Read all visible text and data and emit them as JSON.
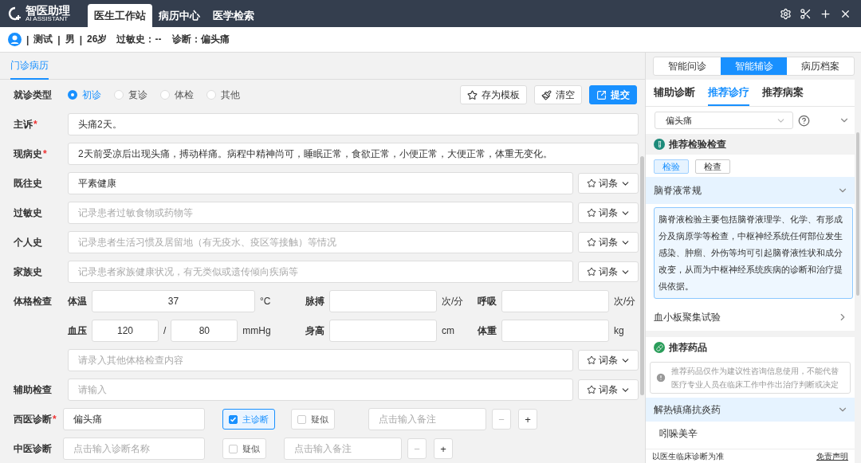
{
  "header": {
    "logo": {
      "name": "智医助理",
      "tagline": "AI ASSISTANT"
    },
    "nav": [
      {
        "label": "医生工作站",
        "selected": true
      },
      {
        "label": "病历中心",
        "selected": false
      },
      {
        "label": "医学检索",
        "selected": false
      }
    ]
  },
  "patient": {
    "separator": "|",
    "name": "测试",
    "sex": "男",
    "age": "26岁",
    "allergy_label": "过敏史：",
    "allergy": "--",
    "diagnosis_label": "诊断：",
    "diagnosis": "偏头痛"
  },
  "record_tabs": [
    {
      "label": "门诊病历",
      "selected": true
    }
  ],
  "visit_type": {
    "label": "就诊类型",
    "options": [
      {
        "label": "初诊",
        "selected": true
      },
      {
        "label": "复诊",
        "selected": false
      },
      {
        "label": "体检",
        "selected": false
      },
      {
        "label": "其他",
        "selected": false
      }
    ]
  },
  "actions": [
    {
      "label": "存为模板",
      "kind": "template"
    },
    {
      "label": "清空",
      "kind": "clear"
    },
    {
      "label": "提交",
      "kind": "submit"
    }
  ],
  "history": [
    {
      "label": "主诉",
      "mark": "*",
      "value": "头痛2天。"
    },
    {
      "label": "现病史",
      "mark": "*",
      "value": "2天前受凉后出现头痛，搏动样痛。病程中精神尚可，睡眠正常，食欲正常，小便正常，大便正常，体重无变化。"
    },
    {
      "label": "既往史",
      "value": "平素健康",
      "phrases": "词条"
    },
    {
      "label": "过敏史",
      "placeholder": "记录患者过敏食物或药物等",
      "phrases": "词条"
    },
    {
      "label": "个人史",
      "placeholder": "记录患者生活习惯及居留地（有无疫水、疫区等接触）等情况",
      "phrases": "词条"
    },
    {
      "label": "家族史",
      "placeholder": "记录患者家族健康状况，有无类似或遗传倾向疾病等",
      "phrases": "词条"
    }
  ],
  "physical": {
    "label": "体格检查",
    "vitals": [
      [
        {
          "label": "体温",
          "values": [
            "37"
          ],
          "unit": "°C"
        },
        {
          "label": "脉搏",
          "unit": "次/分"
        },
        {
          "label": "呼吸",
          "unit": "次/分"
        }
      ],
      [
        {
          "label": "血压",
          "values": [
            "120",
            "80"
          ],
          "separator": "/",
          "unit": "mmHg"
        },
        {
          "label": "身高",
          "unit": "cm"
        },
        {
          "label": "体重",
          "unit": "kg"
        }
      ]
    ],
    "other": {
      "placeholder": "请录入其他体格检查内容",
      "phrases": "词条"
    }
  },
  "auxiliary": {
    "label": "辅助检查",
    "placeholder": "请输入",
    "phrases": "词条"
  },
  "diagnoses": [
    {
      "label": "西医诊断",
      "mark": "*",
      "value": "偏头痛",
      "main": {
        "label": "主诊断",
        "checked": true
      },
      "suspect": {
        "label": "疑似",
        "checked": false
      },
      "note_placeholder": "点击输入备注",
      "minus": "−",
      "plus": "+"
    },
    {
      "label": "中医诊断",
      "placeholder": "点击输入诊断名称",
      "suspect": {
        "label": "疑似",
        "checked": false
      },
      "note_placeholder": "点击输入备注",
      "minus": "−",
      "plus": "+"
    }
  ],
  "assistant": {
    "tabs": [
      {
        "label": "智能问诊",
        "selected": false
      },
      {
        "label": "智能辅诊",
        "selected": true
      },
      {
        "label": "病历档案",
        "selected": false
      }
    ],
    "subtabs": [
      {
        "label": "辅助诊断",
        "selected": false
      },
      {
        "label": "推荐诊疗",
        "selected": true
      },
      {
        "label": "推荐病案",
        "selected": false
      }
    ],
    "disease": "偏头痛",
    "exams": {
      "title": "推荐检验检查",
      "filters": [
        {
          "label": "检验",
          "selected": true
        },
        {
          "label": "检查",
          "selected": false
        }
      ],
      "items": [
        {
          "name": "脑脊液常规",
          "expanded": true,
          "description": "脑脊液检验主要包括脑脊液理学、化学、有形成分及病原学等检查，中枢神经系统任何部位发生感染、肿瘤、外伤等均可引起脑脊液性状和成分改变，从而为中枢神经系统疾病的诊断和治疗提供依据。"
        },
        {
          "name": "血小板聚集试验",
          "expanded": false
        }
      ]
    },
    "drugs": {
      "title": "推荐药品",
      "notice": "推荐药品仅作为建议性咨询信息使用，不能代替医疗专业人员在临床工作中作出治疗判断或决定",
      "groups": [
        {
          "name": "解热镇痛抗炎药",
          "expanded": true,
          "items": [
            "吲哚美辛"
          ]
        }
      ]
    },
    "footer": {
      "note": "以医生临床诊断为准",
      "link": "免责声明"
    }
  }
}
